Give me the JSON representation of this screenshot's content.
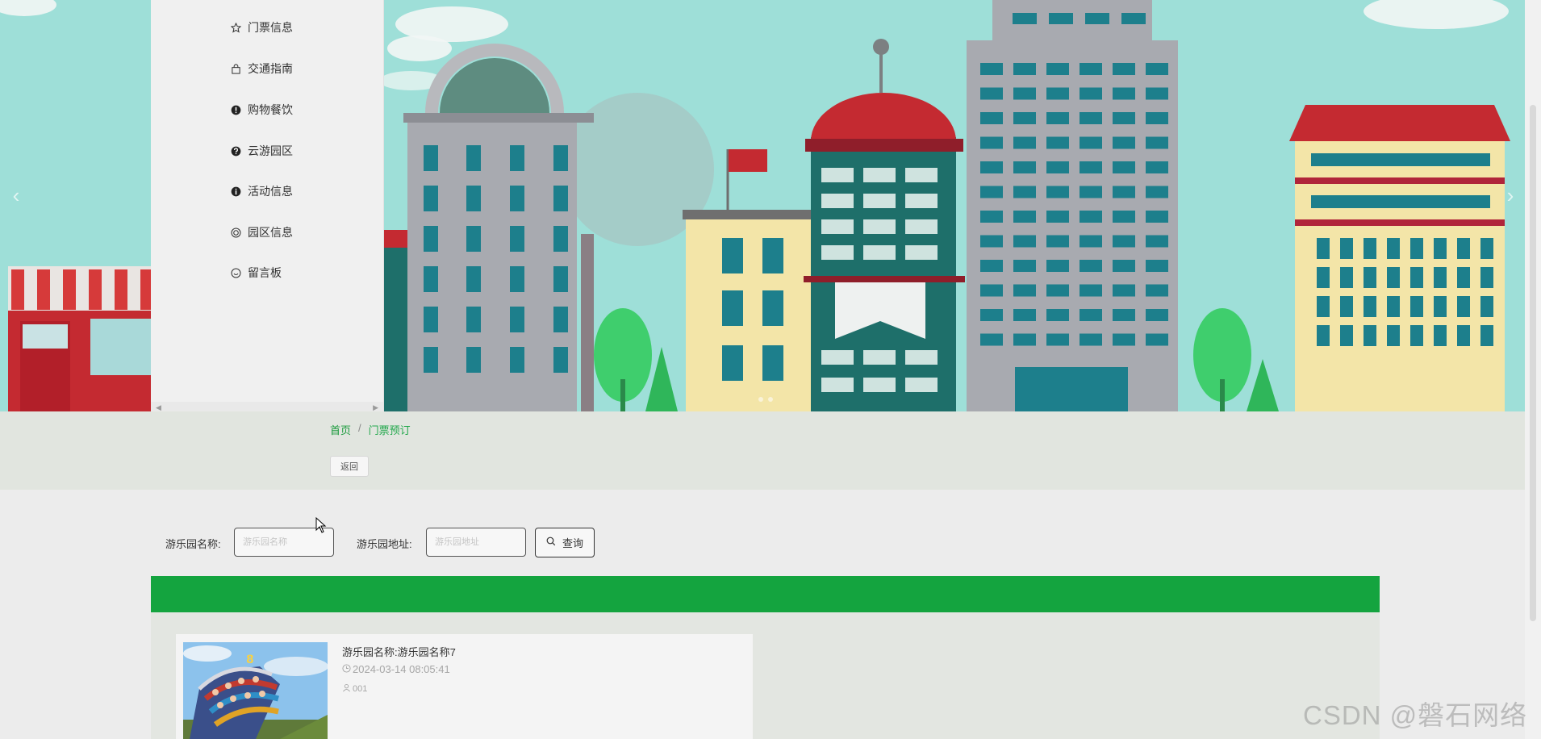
{
  "nav_menu": {
    "items": [
      {
        "label": "门票信息",
        "icon": "star-icon"
      },
      {
        "label": "交通指南",
        "icon": "bag-icon"
      },
      {
        "label": "购物餐饮",
        "icon": "exclamation-circle-icon"
      },
      {
        "label": "云游园区",
        "icon": "question-circle-icon"
      },
      {
        "label": "活动信息",
        "icon": "info-circle-icon"
      },
      {
        "label": "园区信息",
        "icon": "target-icon"
      },
      {
        "label": "留言板",
        "icon": "smile-icon"
      }
    ]
  },
  "breadcrumb": {
    "home": "首页",
    "separator": "/",
    "current": "门票预订"
  },
  "back_button": {
    "label": "返回"
  },
  "search": {
    "name_label": "游乐园名称:",
    "name_placeholder": "游乐园名称",
    "address_label": "游乐园地址:",
    "address_placeholder": "游乐园地址",
    "button_label": "查询"
  },
  "listing": {
    "items": [
      {
        "title": "游乐园名称:游乐园名称7",
        "date": "2024-03-14 08:05:41",
        "views": "001"
      }
    ]
  },
  "watermark": "CSDN @磐石网络",
  "colors": {
    "accent_green": "#14a43f",
    "breadcrumb_green": "#1a9a3c",
    "sky": "#9edfd8"
  }
}
